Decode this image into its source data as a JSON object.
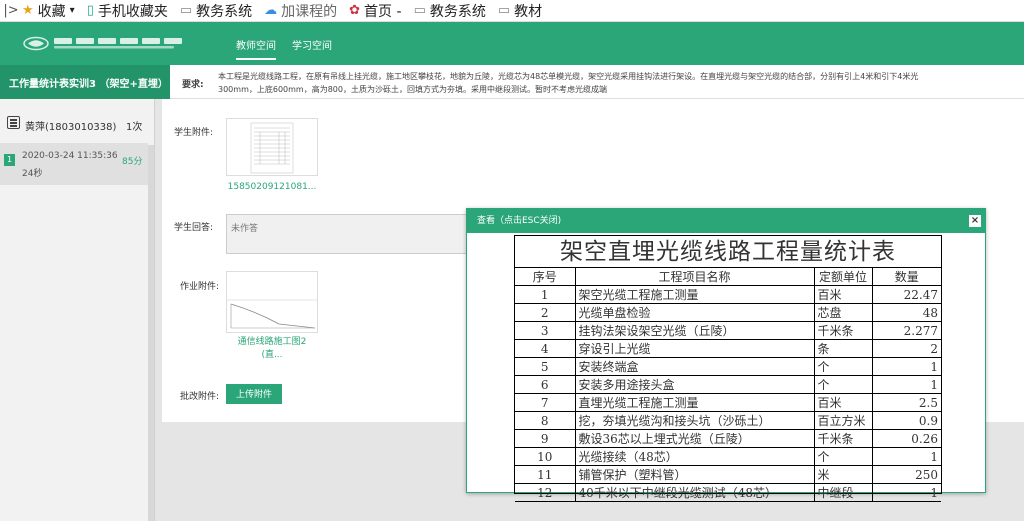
{
  "bookmarks": {
    "lead": "|>",
    "items": [
      {
        "label": "收藏",
        "icon": "star-icon"
      },
      {
        "label": "手机收藏夹",
        "icon": "phone-icon"
      },
      {
        "label": "教务系统",
        "icon": "page-icon"
      },
      {
        "label": "加课程的",
        "icon": "cloud-icon"
      },
      {
        "label": "首页 -",
        "icon": "flower-icon"
      },
      {
        "label": "教务系统",
        "icon": "page-icon"
      },
      {
        "label": "教材",
        "icon": "page-icon"
      }
    ]
  },
  "header": {
    "nav": [
      "教师空间",
      "学习空间"
    ]
  },
  "titlebar": {
    "title": "工作量统计表实训3 （架空+直埋）"
  },
  "requirement": {
    "label": "要求:",
    "line1": "本工程是光缆线路工程，在原有吊线上挂光缆，施工地区攀枝花，地貌为丘陵，光缆芯为48芯单模光缆，架空光缆采用挂钩法进行架设。在直埋光缆与架空光缆的结合部，分别有引上4米和引下4米光",
    "line2": "300mm，上底600mm，高为800，土质为沙砾土，回填方式为夯填。采用中继段测试。暂时不考虑光缆成端"
  },
  "student": {
    "name": "黄萍(1803010338)",
    "count": "1次"
  },
  "attempt": {
    "index": "1",
    "date": "2020-03-24 11:35:36",
    "duration": "24秒",
    "score": "85分"
  },
  "main": {
    "student_attachment_label": "学生附件:",
    "student_attachment_caption": "15850209121081...",
    "student_answer_label": "学生回答:",
    "student_answer_value": "未作答",
    "homework_attachment_label": "作业附件:",
    "homework_attachment_caption1": "通信线路施工图2",
    "homework_attachment_caption2": "(直...",
    "correction_label": "批改附件:",
    "upload_button": "上传附件"
  },
  "modal": {
    "title": "查看（点击ESC关闭)",
    "close": "×",
    "sheet_title": "架空直埋光缆线路工程量统计表",
    "columns": [
      "序号",
      "工程项目名称",
      "定额单位",
      "数量"
    ],
    "rows": [
      {
        "no": "1",
        "name": "架空光缆工程施工测量",
        "unit": "百米",
        "qty": "22.47"
      },
      {
        "no": "2",
        "name": "光缆单盘检验",
        "unit": "芯盘",
        "qty": "48"
      },
      {
        "no": "3",
        "name": "挂钩法架设架空光缆（丘陵）",
        "unit": "千米条",
        "qty": "2.277"
      },
      {
        "no": "4",
        "name": "穿设引上光缆",
        "unit": "条",
        "qty": "2"
      },
      {
        "no": "5",
        "name": "安装终端盒",
        "unit": "个",
        "qty": "1"
      },
      {
        "no": "6",
        "name": "安装多用途接头盒",
        "unit": "个",
        "qty": "1"
      },
      {
        "no": "7",
        "name": "直埋光缆工程施工测量",
        "unit": "百米",
        "qty": "2.5"
      },
      {
        "no": "8",
        "name": "挖，夯填光缆沟和接头坑（沙砾土）",
        "unit": "百立方米",
        "qty": "0.9"
      },
      {
        "no": "9",
        "name": "敷设36芯以上埋式光缆（丘陵）",
        "unit": "千米条",
        "qty": "0.26"
      },
      {
        "no": "10",
        "name": "光缆接续（48芯）",
        "unit": "个",
        "qty": "1"
      },
      {
        "no": "11",
        "name": "铺管保护（塑料管）",
        "unit": "米",
        "qty": "250"
      },
      {
        "no": "12",
        "name": "40千米以下中继段光缆测试（48芯）",
        "unit": "中继段",
        "qty": "1"
      }
    ]
  },
  "colors": {
    "brand_green": "#2aa678",
    "title_green": "#23946a"
  }
}
